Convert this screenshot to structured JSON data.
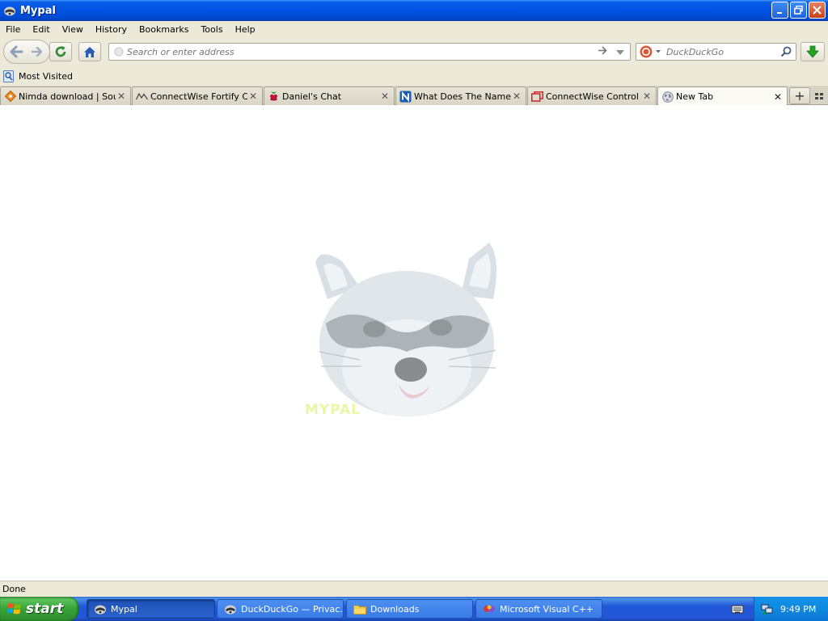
{
  "window": {
    "title": "Mypal"
  },
  "menu": {
    "items": [
      "File",
      "Edit",
      "View",
      "History",
      "Bookmarks",
      "Tools",
      "Help"
    ]
  },
  "navbar": {
    "address_placeholder": "Search or enter address",
    "search_placeholder": "DuckDuckGo"
  },
  "bookmarks": {
    "items": [
      "Most Visited"
    ]
  },
  "tabs": [
    {
      "label": "Nimda download | Sou...",
      "icon": "orange-diamond-icon"
    },
    {
      "label": "ConnectWise Fortify C...",
      "icon": "mountain-icon"
    },
    {
      "label": "Daniel's Chat",
      "icon": "raspberry-icon"
    },
    {
      "label": "What Does The Name ...",
      "icon": "n-logo-icon"
    },
    {
      "label": "ConnectWise Control ...",
      "icon": "red-window-icon"
    },
    {
      "label": "New Tab",
      "icon": "globe-icon",
      "active": true
    }
  ],
  "content": {
    "watermark_label": "MYPAL"
  },
  "status": {
    "text": "Done"
  },
  "taskbar": {
    "start_label": "start",
    "buttons": [
      {
        "label": "Mypal",
        "active": true
      },
      {
        "label": "DuckDuckGo — Privac...",
        "active": false
      },
      {
        "label": "Downloads",
        "active": false
      },
      {
        "label": "Microsoft Visual C++",
        "active": false
      }
    ],
    "clock": "9:49 PM"
  },
  "colors": {
    "titlebar": "#0054e3",
    "chrome": "#ece9d8",
    "taskbar": "#2157d7",
    "start": "#37a237",
    "tray": "#0f8ae0"
  }
}
